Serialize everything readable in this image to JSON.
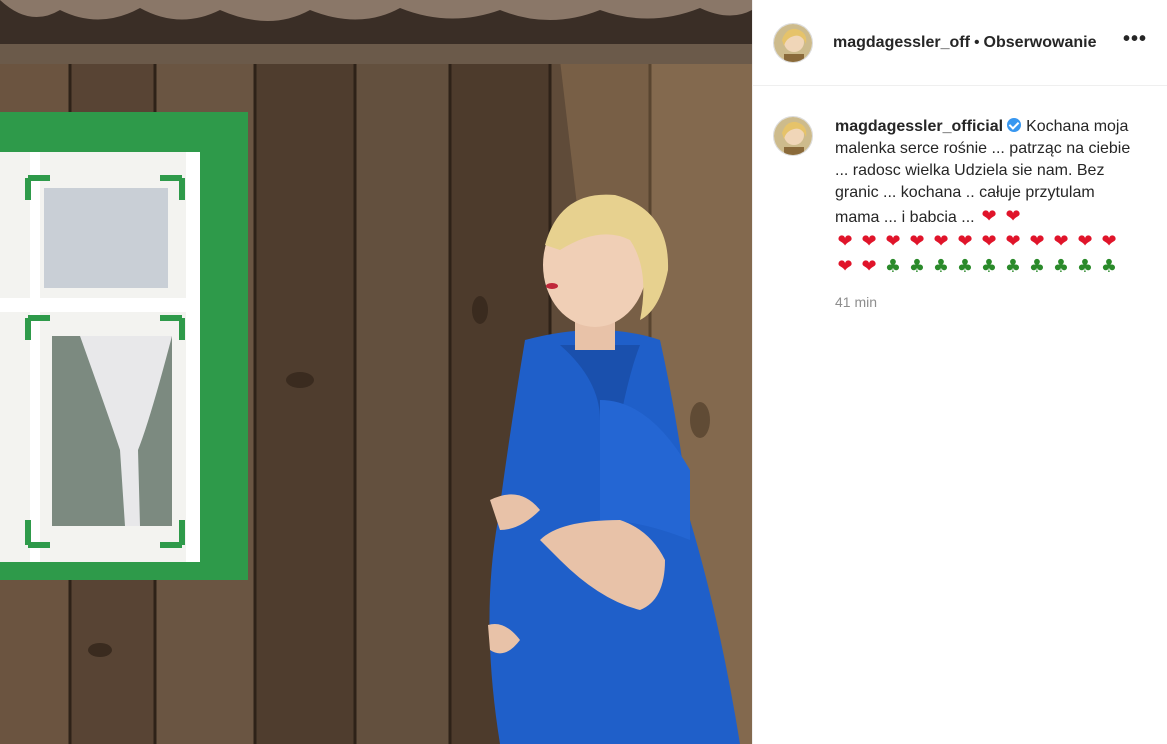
{
  "header": {
    "username": "magdagessler_off",
    "separator": "•",
    "follow_label": "Obserwowanie",
    "more_label": "•••"
  },
  "comment": {
    "username": "magdagessler_official",
    "verified_icon": "verified-badge-icon",
    "text": "Kochana moja malenka serce rośnie ... patrząc na ciebie ... radosc wielka Udziela sie nam. Bez granic ... kochana .. całuje przytulam mama ... i babcia ...",
    "emoji_row1": [
      "❤",
      "❤"
    ],
    "emoji_row2": [
      "❤",
      "❤",
      "❤",
      "❤",
      "❤",
      "❤",
      "❤",
      "❤",
      "❤",
      "❤",
      "❤",
      "❤"
    ],
    "emoji_row3": [
      "❤",
      "❤",
      "♣",
      "♣",
      "♣",
      "♣",
      "♣",
      "♣",
      "♣",
      "♣",
      "♣",
      "♣"
    ],
    "timestamp": "41 min"
  },
  "colors": {
    "heart": "#e0142a",
    "clover": "#2a8a2a",
    "verified": "#3897f0",
    "dress": "#1f5fc9",
    "window_frame": "#2e9a4a"
  }
}
